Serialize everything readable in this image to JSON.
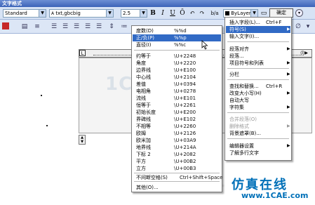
{
  "dialog": {
    "title": "文字格式",
    "style_value": "Standard",
    "font_value": "txt,gbcbig",
    "height_value": "2.5",
    "bold": "B",
    "italic": "I",
    "underline": "U",
    "overline": "Ō",
    "undo": "↶",
    "redo": "↷",
    "stack": "b/a",
    "color_value": "ByLayer",
    "ok_label": "确定",
    "ruler_L": "L",
    "ruler_right": "⟨l⟩▶"
  },
  "symbol_menu": {
    "items": [
      {
        "label": "度数(D)",
        "code": "%%d"
      },
      {
        "label": "正/负(P)",
        "code": "%%p"
      },
      {
        "label": "直径(I)",
        "code": "%%c"
      },
      {
        "label": "约等于",
        "code": "\\U+2248"
      },
      {
        "label": "角度",
        "code": "\\U+2220"
      },
      {
        "label": "边界线",
        "code": "\\U+E100"
      },
      {
        "label": "中心线",
        "code": "\\U+2104"
      },
      {
        "label": "差值",
        "code": "\\U+0394"
      },
      {
        "label": "电相角",
        "code": "\\U+0278"
      },
      {
        "label": "流线",
        "code": "\\U+E101"
      },
      {
        "label": "恒等于",
        "code": "\\U+2261"
      },
      {
        "label": "初始长度",
        "code": "\\U+E200"
      },
      {
        "label": "界碑线",
        "code": "\\U+E102"
      },
      {
        "label": "不相等",
        "code": "\\U+2260"
      },
      {
        "label": "欧姆",
        "code": "\\U+2126"
      },
      {
        "label": "欧米加",
        "code": "\\U+03A9"
      },
      {
        "label": "地界线",
        "code": "\\U+214A"
      },
      {
        "label": "下标 2",
        "code": "\\U+2082"
      },
      {
        "label": "平方",
        "code": "\\U+00B2"
      },
      {
        "label": "立方",
        "code": "\\U+00B3"
      },
      {
        "label": "不间断空格(S)",
        "code": "Ctrl+Shift+Space"
      },
      {
        "label": "其他(O)...",
        "code": ""
      }
    ],
    "selected_index": 1
  },
  "context_menu": {
    "items": [
      {
        "label": "插入字段(L)...",
        "accel": "Ctrl+F"
      },
      {
        "label": "符号(S)",
        "accel": ""
      },
      {
        "label": "输入文字(I)...",
        "accel": ""
      },
      {
        "label": "段落对齐",
        "accel": ""
      },
      {
        "label": "段落...",
        "accel": ""
      },
      {
        "label": "项目符号和列表",
        "accel": ""
      },
      {
        "label": "分栏",
        "accel": ""
      },
      {
        "label": "查找和替换...",
        "accel": "Ctrl+R"
      },
      {
        "label": "改变大小写(H)",
        "accel": ""
      },
      {
        "label": "自动大写",
        "accel": ""
      },
      {
        "label": "字符集",
        "accel": ""
      },
      {
        "label": "合并段落(O)",
        "accel": ""
      },
      {
        "label": "删除格式",
        "accel": ""
      },
      {
        "label": "背景遮罩(B)...",
        "accel": ""
      },
      {
        "label": "编辑器设置",
        "accel": ""
      },
      {
        "label": "了解多行文字",
        "accel": ""
      }
    ],
    "submenu_arrow": "▶"
  },
  "watermark": "1CAE.COM",
  "brand": {
    "name": "仿真在线",
    "url": "www.1CAE.com"
  }
}
